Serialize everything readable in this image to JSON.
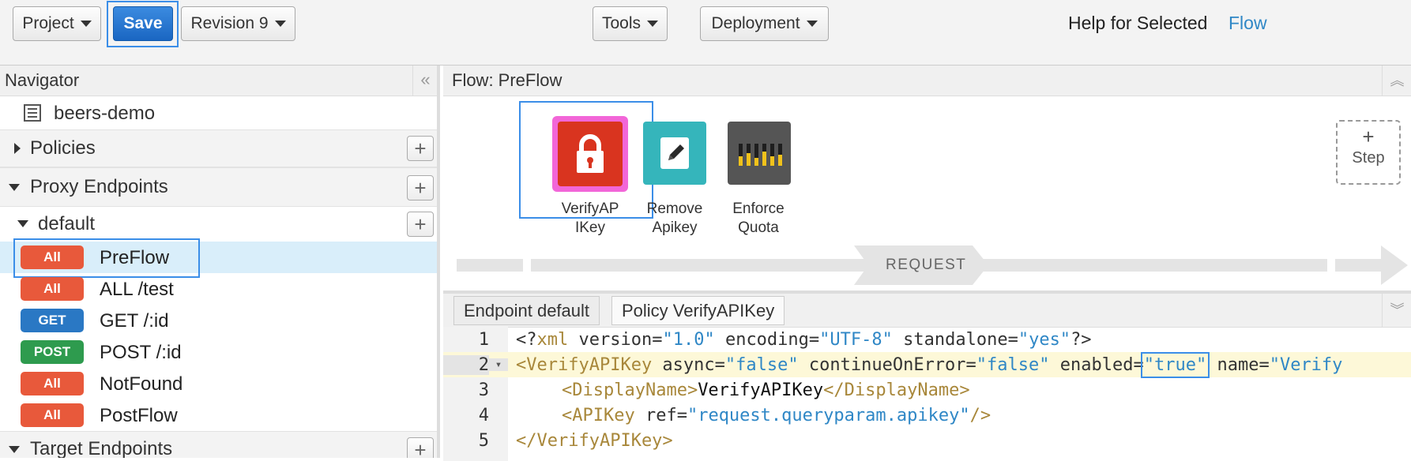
{
  "toolbar": {
    "project_label": "Project",
    "save_label": "Save",
    "revision_label": "Revision 9",
    "tools_label": "Tools",
    "deployment_label": "Deployment",
    "help_text": "Help for Selected",
    "help_link": "Flow"
  },
  "navigator": {
    "title": "Navigator",
    "collapse_glyph": "«",
    "proxy_name": "beers-demo",
    "policies_label": "Policies",
    "proxy_endpoints_label": "Proxy Endpoints",
    "default_label": "default",
    "target_endpoints_label": "Target Endpoints",
    "flows": [
      {
        "badge": "All",
        "label": "PreFlow",
        "color": "#e8593b"
      },
      {
        "badge": "All",
        "label": "ALL /test",
        "color": "#e8593b"
      },
      {
        "badge": "GET",
        "label": "GET /:id",
        "color": "#2a78c4"
      },
      {
        "badge": "POST",
        "label": "POST /:id",
        "color": "#2e9b4e"
      },
      {
        "badge": "All",
        "label": "NotFound",
        "color": "#e8593b"
      },
      {
        "badge": "All",
        "label": "PostFlow",
        "color": "#e8593b"
      }
    ]
  },
  "flow": {
    "title": "Flow: PreFlow",
    "policies": [
      {
        "line1": "VerifyAP",
        "line2": "IKey",
        "icon": "lock-icon",
        "color": "#d9341f"
      },
      {
        "line1": "Remove",
        "line2": "Apikey",
        "icon": "pencil-icon",
        "color": "#35b5bb"
      },
      {
        "line1": "Enforce",
        "line2": "Quota",
        "icon": "quota-bars-icon",
        "color": "#555555"
      }
    ],
    "step_plus": "+",
    "step_label": "Step",
    "request_label": "REQUEST"
  },
  "editor": {
    "tabs": [
      "Endpoint default",
      "Policy VerifyAPIKey"
    ],
    "lines": [
      {
        "n": "1",
        "fold": ""
      },
      {
        "n": "2",
        "fold": "▾"
      },
      {
        "n": "3",
        "fold": ""
      },
      {
        "n": "4",
        "fold": ""
      },
      {
        "n": "5",
        "fold": ""
      }
    ],
    "code": {
      "l1_a": "<?",
      "l1_b": "xml",
      "l1_c": " version=",
      "l1_d": "\"1.0\"",
      "l1_e": " encoding=",
      "l1_f": "\"UTF-8\"",
      "l1_g": " standalone=",
      "l1_h": "\"yes\"",
      "l1_i": "?>",
      "l2_a": "<VerifyAPIKey",
      "l2_b": " async=",
      "l2_c": "\"false\"",
      "l2_d": " continueOnError=",
      "l2_e": "\"false\"",
      "l2_f": " enabled=",
      "l2_g": "\"true\"",
      "l2_h": " name=",
      "l2_i": "\"Verify",
      "l3_a": "<DisplayName>",
      "l3_b": "VerifyAPIKey",
      "l3_c": "</DisplayName>",
      "l4_a": "<APIKey",
      "l4_b": " ref=",
      "l4_c": "\"request.queryparam.apikey\"",
      "l4_d": "/>",
      "l5_a": "</VerifyAPIKey>"
    }
  }
}
